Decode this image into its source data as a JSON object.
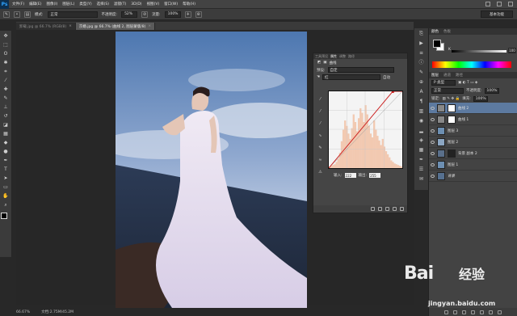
{
  "menu": {
    "logo": "Ps",
    "items": [
      "文件(F)",
      "编辑(E)",
      "图像(I)",
      "图层(L)",
      "类型(Y)",
      "选择(S)",
      "滤镜(T)",
      "3D(D)",
      "视图(V)",
      "窗口(W)",
      "帮助(H)"
    ]
  },
  "options": {
    "mode_label": "模式:",
    "mode_value": "正常",
    "opacity_label": "不透明度:",
    "opacity_value": "52%",
    "flow_label": "流量:",
    "flow_value": "100%",
    "workspace": "基本功能"
  },
  "tabs": [
    {
      "label": "卸载.jpg @ 66.7% (RGB/8)",
      "close": "×",
      "active": false
    },
    {
      "label": "京婚.jpg @ 66.7% (曲线 2, 图层蒙版/8)",
      "close": "×",
      "active": true
    }
  ],
  "status": {
    "zoom": "66.67%",
    "doc": "文档:2.75M/45.2M"
  },
  "curves": {
    "tabs": [
      "工具预设",
      "属性",
      "调整",
      "路径"
    ],
    "active_tab": "属性",
    "title": "曲线",
    "preset_label": "预设:",
    "preset_value": "自定",
    "channel_value": "红",
    "auto_label": "自动",
    "input_label": "输入:",
    "input_value": "222",
    "output_label": "输出:",
    "output_value": "255",
    "histogram": [
      2,
      3,
      4,
      5,
      8,
      12,
      20,
      35,
      50,
      62,
      55,
      45,
      38,
      52,
      70,
      60,
      48,
      65,
      78,
      72,
      60,
      82,
      70,
      55,
      45,
      40,
      62,
      50,
      42,
      36,
      30,
      38,
      28,
      22,
      18,
      14,
      10,
      8,
      6,
      5,
      4,
      3,
      2
    ]
  },
  "color_panel": {
    "tabs": [
      "颜色",
      "色板"
    ],
    "k_label": "K",
    "k_value": "100"
  },
  "layers_panel": {
    "tabs": [
      "图层",
      "通道",
      "路径"
    ],
    "kind_label": "P 类型",
    "blend_value": "正常",
    "opacity_label": "不透明度:",
    "opacity_value": "100%",
    "lock_label": "锁定:",
    "fill_label": "填充:",
    "fill_value": "100%",
    "layers": [
      {
        "name": "曲线 2",
        "selected": true,
        "thumb": "#ffffff"
      },
      {
        "name": "曲线 1",
        "selected": false,
        "thumb": "#ffffff"
      },
      {
        "name": "图层 3",
        "selected": false,
        "thumb": "#6d8fb2"
      },
      {
        "name": "图层 2",
        "selected": false,
        "thumb": "#8ca6c2"
      },
      {
        "name": "背景 副本 2",
        "selected": false,
        "thumb": "#5a6f8a"
      },
      {
        "name": "图层 1",
        "selected": false,
        "thumb": "#6d8fb2"
      },
      {
        "name": "背景",
        "selected": false,
        "thumb": "#56708f"
      }
    ]
  },
  "watermark": {
    "brand": "Bai",
    "brand2": "经验",
    "url": "jingyan.baidu.com"
  },
  "colors": {
    "accent": "#5d7aa0",
    "panel": "#434343",
    "curve_red": "#cc2222",
    "histogram_fill": "#f2c9b1"
  }
}
